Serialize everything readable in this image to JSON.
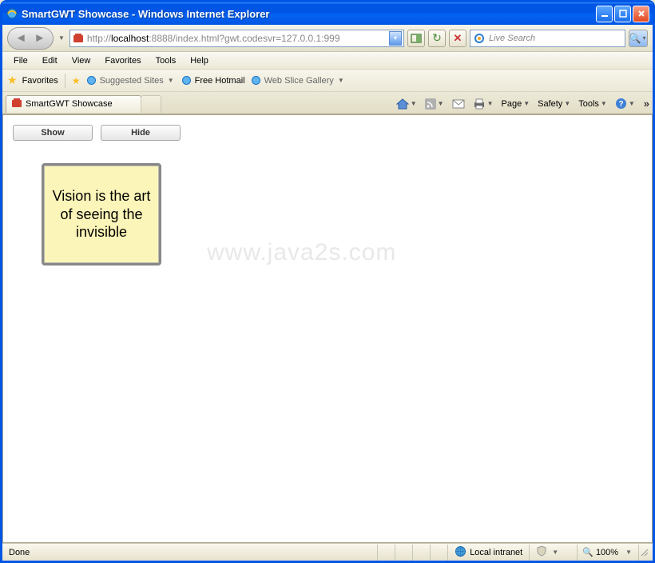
{
  "window": {
    "title": "SmartGWT Showcase - Windows Internet Explorer"
  },
  "address": {
    "proto": "http://",
    "host": "localhost",
    "port_path": ":8888/index.html?gwt.codesvr=127.0.0.1:999"
  },
  "search": {
    "placeholder": "Live Search"
  },
  "menu": {
    "file": "File",
    "edit": "Edit",
    "view": "View",
    "favorites": "Favorites",
    "tools": "Tools",
    "help": "Help"
  },
  "favbar": {
    "favorites": "Favorites",
    "suggested": "Suggested Sites",
    "hotmail": "Free Hotmail",
    "webslice": "Web Slice Gallery"
  },
  "tab": {
    "label": "SmartGWT Showcase"
  },
  "cmd": {
    "page": "Page",
    "safety": "Safety",
    "tools": "Tools"
  },
  "buttons": {
    "show": "Show",
    "hide": "Hide"
  },
  "note": {
    "text": "Vision is the art of seeing the invisible"
  },
  "watermark": "www.java2s.com",
  "status": {
    "done": "Done",
    "zone": "Local intranet",
    "zoom": "100%"
  }
}
